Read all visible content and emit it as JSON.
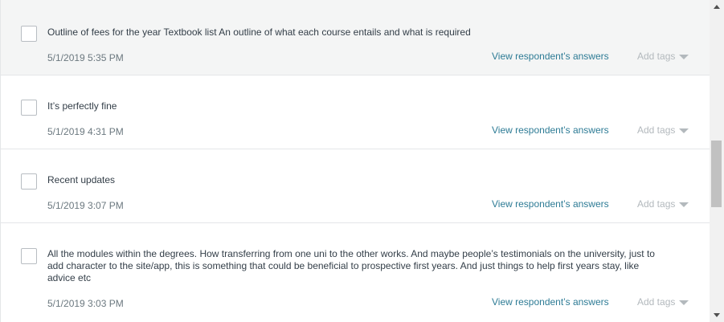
{
  "responses": [
    {
      "text": "Outline of fees for the year Textbook list An outline of what each course entails and what is required",
      "date": "5/1/2019 5:35 PM",
      "link_label": "View respondent’s answers",
      "tags_label": "Add tags"
    },
    {
      "text": "It’s perfectly fine",
      "date": "5/1/2019 4:31 PM",
      "link_label": "View respondent’s answers",
      "tags_label": "Add tags"
    },
    {
      "text": "Recent updates",
      "date": "5/1/2019 3:07 PM",
      "link_label": "View respondent’s answers",
      "tags_label": "Add tags"
    },
    {
      "text": "All the modules within the degrees. How transferring from one uni to the other works. And maybe people’s testimonials on the university, just to add character to the site/app, this is something that could be beneficial to prospective first years. And just things to help first years stay, like advice etc",
      "date": "5/1/2019 3:03 PM",
      "link_label": "View respondent’s answers",
      "tags_label": "Add tags"
    }
  ],
  "colors": {
    "link": "#2d7b95",
    "text": "#333e48",
    "muted": "#6b787f",
    "highlight_row": "#f4f5f5"
  },
  "icons": {
    "tags_caret": "caret-down-icon",
    "scroll_up": "scroll-up-arrow-icon",
    "scroll_down": "scroll-down-arrow-icon"
  }
}
